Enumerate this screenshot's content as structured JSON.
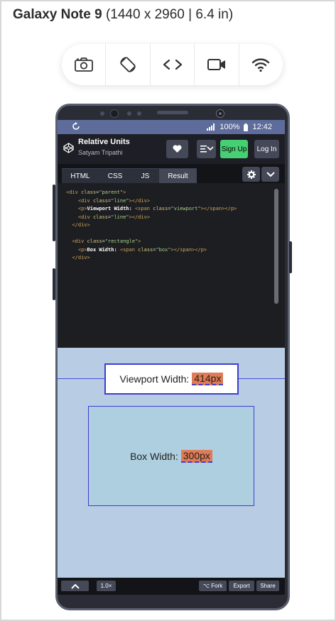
{
  "device": {
    "name": "Galaxy Note 9",
    "specs": "(1440 x 2960 | 6.4 in)"
  },
  "toolbar": {
    "items": [
      {
        "name": "camera-icon"
      },
      {
        "name": "rotate-icon"
      },
      {
        "name": "code-icon"
      },
      {
        "name": "video-icon"
      },
      {
        "name": "wifi-icon"
      }
    ]
  },
  "statusbar": {
    "battery": "100%",
    "time": "12:42"
  },
  "codepen": {
    "title": "Relative Units",
    "author": "Satyam Tripathi",
    "signup_label": "Sign Up",
    "login_label": "Log In",
    "tabs": [
      "HTML",
      "CSS",
      "JS",
      "Result"
    ],
    "active_tab": "Result",
    "accent": "#47cf73"
  },
  "code_lines": [
    "<div class=\"parent\">",
    "    <div class=\"line\"></div>",
    "    <p>Viewport Width: <span class=\"viewport\"></span></p>",
    "    <div class=\"line\"></div>",
    "  </div>",
    "",
    "  <div class=\"rectangle\">",
    "    <p>Box Width: <span class=\"box\"></span></p>",
    "  </div>"
  ],
  "result": {
    "viewport_label": "Viewport Width:",
    "viewport_value": "414px",
    "box_label": "Box Width:",
    "box_value": "300px"
  },
  "footer": {
    "zoom": "1.0×",
    "fork_label": "⌥ Fork",
    "export_label": "Export",
    "share_label": "Share"
  }
}
